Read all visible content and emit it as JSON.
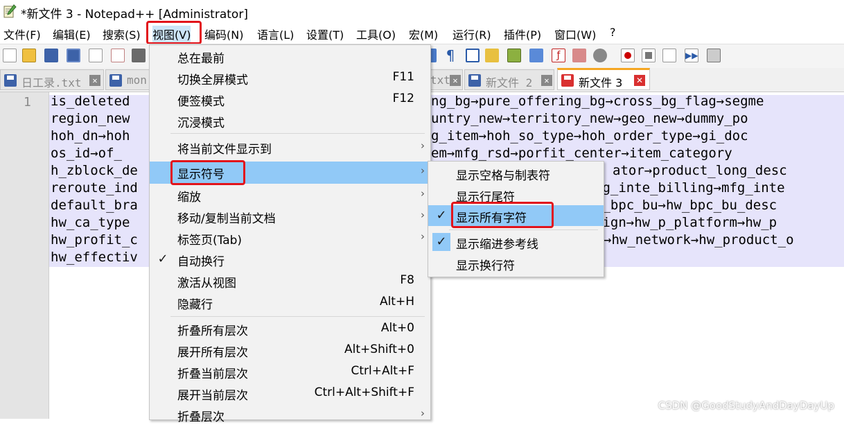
{
  "window": {
    "title": "*新文件 3 - Notepad++ [Administrator]"
  },
  "menubar": [
    "文件(F)",
    "编辑(E)",
    "搜索(S)",
    "视图(V)",
    "编码(N)",
    "语言(L)",
    "设置(T)",
    "工具(O)",
    "宏(M)",
    "运行(R)",
    "插件(P)",
    "窗口(W)",
    "?"
  ],
  "tabs": [
    {
      "label": "日工录.txt"
    },
    {
      "label": "mon"
    },
    {
      "label": "txt"
    },
    {
      "label": "新文件 2"
    },
    {
      "label": "新文件 3"
    }
  ],
  "tab_close_glyph": "✕",
  "editor": {
    "line_number": "1",
    "left_lines": [
      "is_deleted",
      "region_new",
      "hoh_dn→hoh",
      "os_id→of_",
      "h_zblock_de",
      "reroute_ind",
      "default_bra",
      "hw_ca_type",
      "hw_profit_c",
      "hw_effectiv"
    ],
    "right_lines": [
      "ng_bg→pure_offering_bg→cross_bg_flag→segme",
      "untry_new→territory_new→geo_new→dummy_po",
      "g_item→hoh_so_type→hoh_order_type→gi_doc",
      "em→mfg_rsd→porfit_center→item_category",
      "ator→product_long_desc",
      "fg_inte_billing→mfg_inte",
      "w_bpc_bu→hw_bpc_bu_desc",
      "sign→hw_p_platform→hw_p",
      "→hw_network→hw_product_o",
      ""
    ]
  },
  "view_menu": {
    "items": [
      {
        "label": "总在最前",
        "shortcut": ""
      },
      {
        "label": "切换全屏模式",
        "shortcut": "F11"
      },
      {
        "label": "便签模式",
        "shortcut": "F12"
      },
      {
        "label": "沉浸模式",
        "shortcut": ""
      },
      {
        "label": "将当前文件显示到",
        "shortcut": "",
        "submenu": true
      },
      {
        "label": "显示符号",
        "shortcut": "",
        "submenu": true,
        "highlighted": true
      },
      {
        "label": "缩放",
        "shortcut": "",
        "submenu": true
      },
      {
        "label": "移动/复制当前文档",
        "shortcut": "",
        "submenu": true
      },
      {
        "label": "标签页(Tab)",
        "shortcut": "",
        "submenu": true
      },
      {
        "label": "自动换行",
        "shortcut": "",
        "checked": true
      },
      {
        "label": "激活从视图",
        "shortcut": "F8"
      },
      {
        "label": "隐藏行",
        "shortcut": "Alt+H"
      },
      {
        "label": "折叠所有层次",
        "shortcut": "Alt+0"
      },
      {
        "label": "展开所有层次",
        "shortcut": "Alt+Shift+0"
      },
      {
        "label": "折叠当前层次",
        "shortcut": "Ctrl+Alt+F"
      },
      {
        "label": "展开当前层次",
        "shortcut": "Ctrl+Alt+Shift+F"
      },
      {
        "label": "折叠层次",
        "shortcut": "",
        "submenu": true
      }
    ]
  },
  "symbol_submenu": {
    "items": [
      {
        "label": "显示空格与制表符",
        "checked": false
      },
      {
        "label": "显示行尾符",
        "checked": false
      },
      {
        "label": "显示所有字符",
        "checked": true,
        "highlighted": true
      },
      {
        "label": "显示缩进参考线",
        "checked": true
      },
      {
        "label": "显示换行符",
        "checked": false
      }
    ]
  },
  "glyphs": {
    "check": "✓",
    "submenu_arrow": "›"
  },
  "colors": {
    "highlight_box": "#e2141b",
    "menu_hover": "#91c9f7",
    "selection": "#e6e4fb",
    "active_tab_accent": "#f5a623"
  },
  "watermark": "CSDN @GoodStudyAndDayDayUp"
}
